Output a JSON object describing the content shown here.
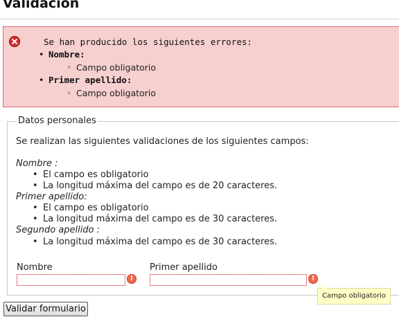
{
  "page": {
    "title": "Validacion"
  },
  "errors": {
    "message": "Se han producido los siguientes errores:",
    "items": [
      {
        "field": "Nombre:",
        "detail": "Campo obligatorio"
      },
      {
        "field": "Primer apellido:",
        "detail": "Campo obligatorio"
      }
    ]
  },
  "section": {
    "legend": "Datos personales",
    "intro": "Se realizan las siguientes validaciones de los siguientes campos:",
    "validations": [
      {
        "field": "Nombre :",
        "rules": [
          "El campo es obligatorio",
          "La longitud máxima del campo es de 20 caracteres."
        ]
      },
      {
        "field": "Primer apellido:",
        "rules": [
          "El campo es obligatorio",
          "La longitud máxima del campo es de 30 caracteres."
        ]
      },
      {
        "field": "Segundo apellido :",
        "rules": [
          "La longitud máxima del campo es de 30 caracteres."
        ]
      }
    ]
  },
  "form": {
    "nombre_label": "Nombre",
    "nombre_value": "",
    "apellido_label": "Primer apellido",
    "apellido_value": "",
    "tooltip": "Campo obligatorio",
    "submit_label": "Validar formulario"
  },
  "icons": {
    "error_box": "error-x-icon",
    "field_warning": "warning-exclamation-icon"
  },
  "colors": {
    "error_background": "#f6cfcf",
    "error_border": "#d46a6a",
    "invalid_field_border": "#d00000",
    "tooltip_background": "#ffffc6"
  }
}
